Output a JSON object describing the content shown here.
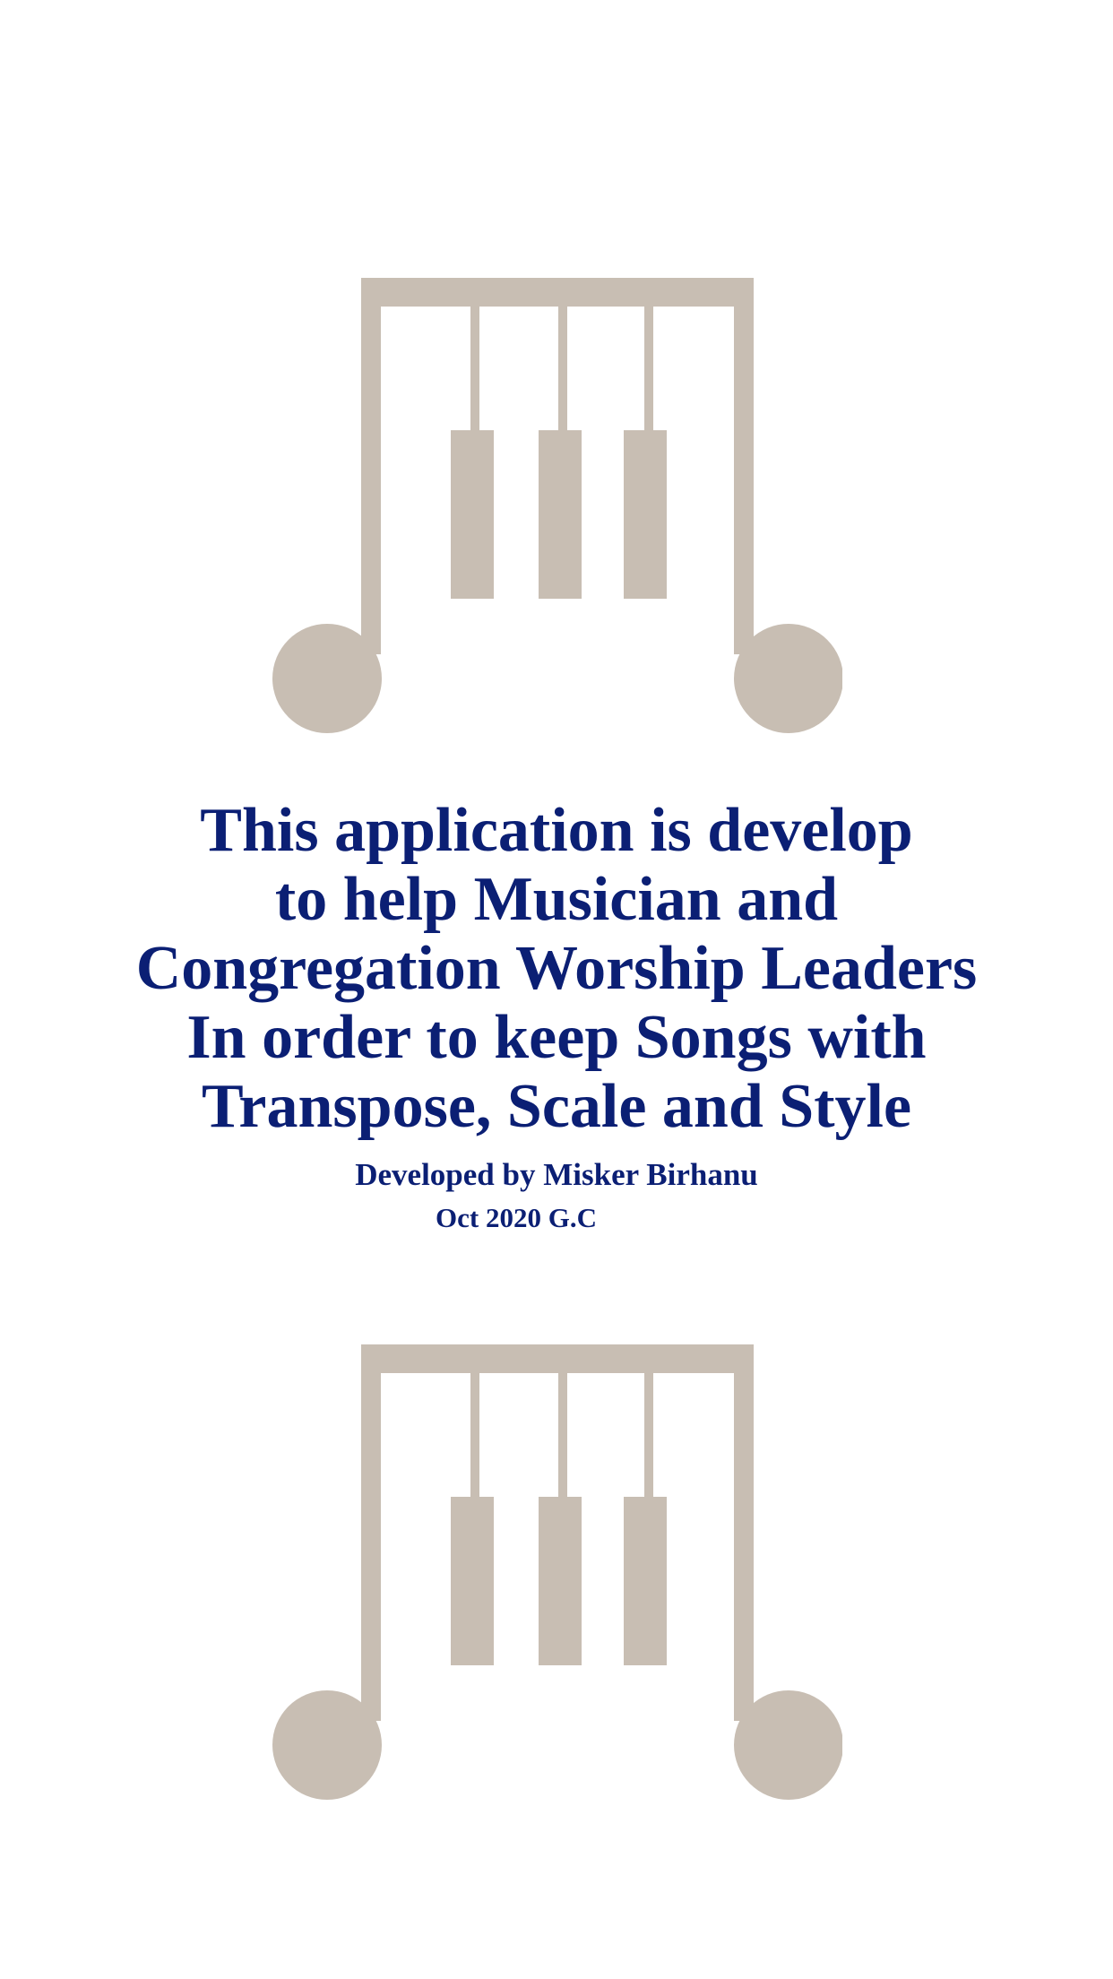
{
  "splash": {
    "logo_icon": "piano-music-note-icon",
    "logo_color": "#c8beb3",
    "text_color": "#0b1f74",
    "message_lines": [
      "This application is develop",
      "to help Musician and",
      "Congregation Worship Leaders",
      "In order to keep Songs with",
      "Transpose, Scale and Style"
    ],
    "developer": "Developed by Misker Birhanu",
    "date": "Oct 2020 G.C"
  }
}
